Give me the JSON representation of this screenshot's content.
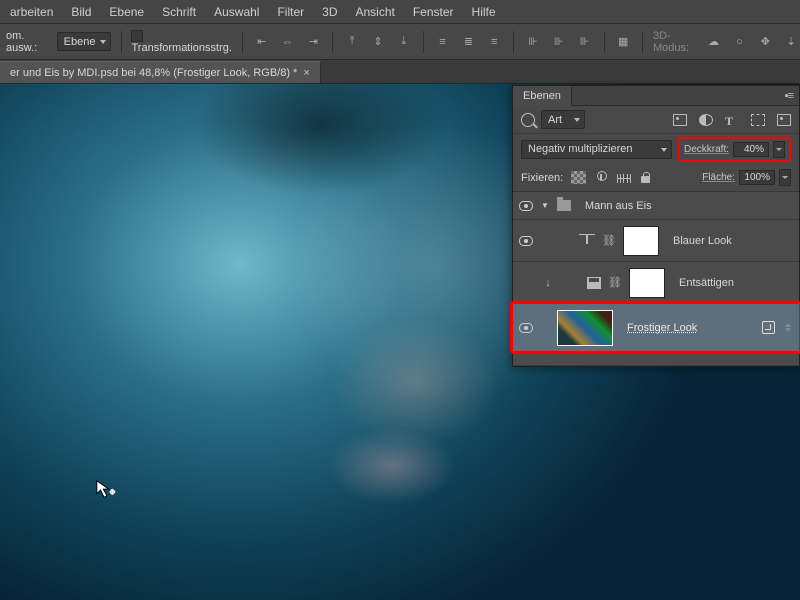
{
  "menu": {
    "items": [
      "arbeiten",
      "Bild",
      "Ebene",
      "Schrift",
      "Auswahl",
      "Filter",
      "3D",
      "Ansicht",
      "Fenster",
      "Hilfe"
    ]
  },
  "options": {
    "left_label": "om. ausw.:",
    "mode_dd": "Ebene",
    "transform_check_label": "Transformationsstrg.",
    "mode3d_label": "3D-Modus:"
  },
  "tab": {
    "title": "er und Eis by MDI.psd bei 48,8% (Frostiger Look, RGB/8) *"
  },
  "panel": {
    "tab_label": "Ebenen",
    "search_kind": "Art",
    "blend_mode": "Negativ multiplizieren",
    "opacity_label": "Deckkraft:",
    "opacity_value": "40%",
    "lock_label": "Fixieren:",
    "fill_label": "Fläche:",
    "fill_value": "100%",
    "group_name": "Mann aus Eis",
    "layer_blauer": "Blauer Look",
    "layer_entsatt": "Entsättigen",
    "layer_frostig": "Frostiger Look"
  }
}
